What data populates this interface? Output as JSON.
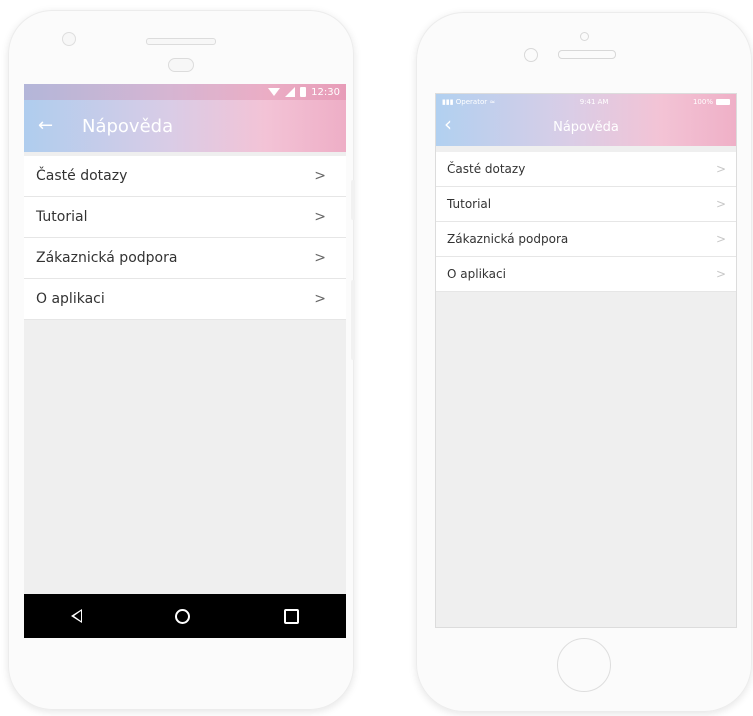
{
  "android": {
    "status_time": "12:30",
    "title": "Nápověda",
    "back_icon": "arrow-left",
    "items": [
      {
        "label": "Časté dotazy",
        "chevron": ">"
      },
      {
        "label": "Tutorial",
        "chevron": ">"
      },
      {
        "label": "Zákaznická podpora",
        "chevron": ">"
      },
      {
        "label": "O aplikaci",
        "chevron": ">"
      }
    ],
    "nav_icons": [
      "back-triangle",
      "home-circle",
      "recent-square"
    ]
  },
  "iphone": {
    "carrier": "Operator",
    "time": "9:41 AM",
    "battery": "100%",
    "title": "Nápověda",
    "back_icon": "chevron-left",
    "items": [
      {
        "label": "Časté dotazy",
        "chevron": ">"
      },
      {
        "label": "Tutorial",
        "chevron": ">"
      },
      {
        "label": "Zákaznická podpora",
        "chevron": ">"
      },
      {
        "label": "O aplikaci",
        "chevron": ">"
      }
    ]
  },
  "colors": {
    "header_gradient_start": "#afcdee",
    "header_gradient_end": "#eeaec6",
    "android_nav_bar": "#000000"
  }
}
